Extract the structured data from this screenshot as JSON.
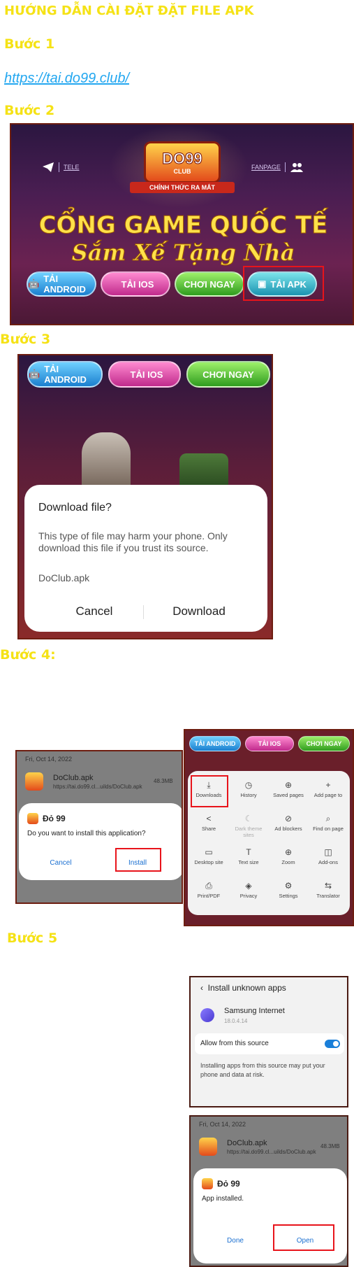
{
  "title": "HƯỚNG DẪN CÀI ĐẶT ĐẶT FILE APK",
  "steps": {
    "s1": "Bước 1",
    "s2": "Bước 2",
    "s3": "Bước 3",
    "s4": "Bước 4:",
    "s5": "Bước 5"
  },
  "link": "https://tai.do99.club/",
  "banner": {
    "logo": "DO99",
    "logo_sub": "CLUB",
    "ribbon": "CHÍNH THỨC RA MẮT",
    "tele": "TELE",
    "fanpage": "FANPAGE",
    "headline1": "CỔNG GAME QUỐC TẾ",
    "headline2": "Sắm Xế Tặng Nhà",
    "buttons": {
      "android": "TẢI ANDROID",
      "ios": "TẢI IOS",
      "play": "CHƠI NGAY",
      "apk": "TẢI APK"
    }
  },
  "download_dialog": {
    "title": "Download file?",
    "message": "This type of file may harm your phone. Only download this file if you trust its source.",
    "file": "DoClub.apk",
    "cancel": "Cancel",
    "download": "Download"
  },
  "install_prompt": {
    "date": "Fri, Oct 14, 2022",
    "file": "DoClub.apk",
    "url": "https://tai.do99.cl...uilds/DoClub.apk",
    "size": "48.3MB",
    "app_name": "Đỏ 99",
    "question": "Do you want to install this application?",
    "cancel": "Cancel",
    "install": "Install"
  },
  "browser_menu": {
    "items": [
      {
        "icon": "⤓",
        "label": "Downloads"
      },
      {
        "icon": "◷",
        "label": "History"
      },
      {
        "icon": "⊕",
        "label": "Saved pages"
      },
      {
        "icon": "+",
        "label": "Add page to"
      },
      {
        "icon": "<",
        "label": "Share"
      },
      {
        "icon": "☾",
        "label": "Dark theme sites"
      },
      {
        "icon": "⊘",
        "label": "Ad blockers"
      },
      {
        "icon": "⌕",
        "label": "Find on page"
      },
      {
        "icon": "▭",
        "label": "Desktop site"
      },
      {
        "icon": "T",
        "label": "Text size"
      },
      {
        "icon": "⊕",
        "label": "Zoom"
      },
      {
        "icon": "◫",
        "label": "Add-ons"
      },
      {
        "icon": "⎙",
        "label": "Print/PDF"
      },
      {
        "icon": "◈",
        "label": "Privacy"
      },
      {
        "icon": "⚙",
        "label": "Settings"
      },
      {
        "icon": "⇆",
        "label": "Translator"
      }
    ]
  },
  "unknown_apps": {
    "header": "Install unknown apps",
    "app": "Samsung Internet",
    "version": "18.0.4.14",
    "allow": "Allow from this source",
    "note": "Installing apps from this source may put your phone and data at risk."
  },
  "installed": {
    "date": "Fri, Oct 14, 2022",
    "file": "DoClub.apk",
    "url": "https://tai.do99.cl...uilds/DoClub.apk",
    "size": "48.3MB",
    "app_name": "Đỏ 99",
    "message": "App installed.",
    "done": "Done",
    "open": "Open"
  }
}
